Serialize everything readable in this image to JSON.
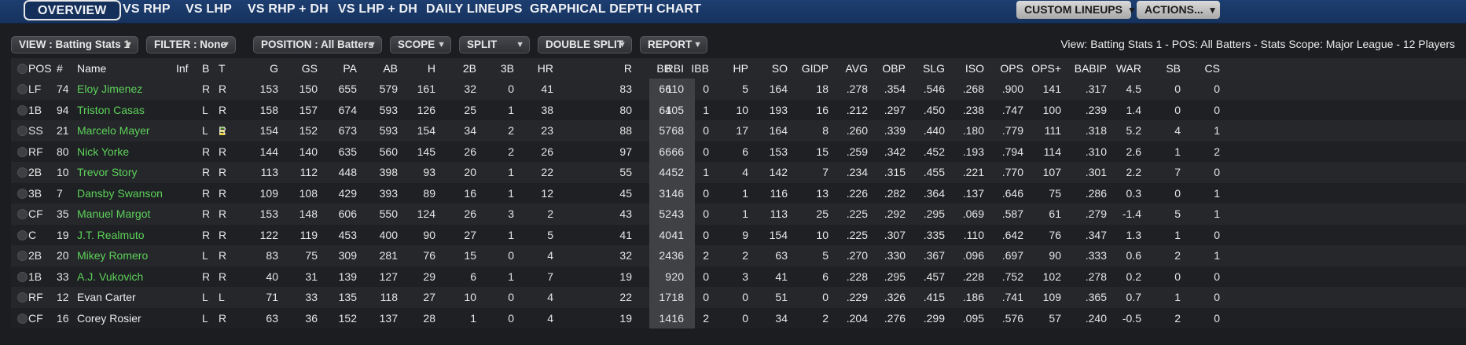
{
  "nav": {
    "tabs": [
      "OVERVIEW",
      "VS RHP",
      "VS LHP",
      "VS RHP + DH",
      "VS LHP + DH",
      "DAILY LINEUPS",
      "GRAPHICAL DEPTH CHART"
    ],
    "custom_lineups": "CUSTOM LINEUPS",
    "actions": "ACTIONS..."
  },
  "filters": {
    "view": "VIEW : Batting Stats 1",
    "filter": "FILTER : None",
    "position": "POSITION : All Batters",
    "scope": "SCOPE",
    "split": "SPLIT",
    "double_split": "DOUBLE SPLIT",
    "report": "REPORT",
    "summary": "View: Batting Stats 1 - POS: All Batters - Stats Scope: Major League - 12 Players"
  },
  "table": {
    "columns": [
      "POS",
      "#",
      "Name",
      "Inf",
      "B",
      "T",
      "G",
      "GS",
      "PA",
      "AB",
      "H",
      "2B",
      "3B",
      "HR",
      "RBI",
      "R",
      "BB",
      "IBB",
      "HP",
      "SO",
      "GIDP",
      "AVG",
      "OBP",
      "SLG",
      "ISO",
      "OPS",
      "OPS+",
      "BABIP",
      "WAR",
      "SB",
      "CS"
    ],
    "rows": [
      {
        "pos": "LF",
        "num": "74",
        "name": "Eloy Jimenez",
        "inj": "",
        "b": "R",
        "t": "R",
        "g": "153",
        "gs": "150",
        "pa": "655",
        "ab": "579",
        "h": "161",
        "d": "32",
        "tr": "0",
        "hr": "41",
        "rbi": "110",
        "r": "83",
        "bb": "66",
        "ibb": "0",
        "hp": "5",
        "so": "164",
        "gidp": "18",
        "avg": ".278",
        "obp": ".354",
        "slg": ".546",
        "iso": ".268",
        "ops": ".900",
        "opsp": "141",
        "babip": ".317",
        "war": "4.5",
        "sb": "0",
        "cs": "0",
        "green": true
      },
      {
        "pos": "1B",
        "num": "94",
        "name": "Triston Casas",
        "inj": "",
        "b": "L",
        "t": "R",
        "g": "158",
        "gs": "157",
        "pa": "674",
        "ab": "593",
        "h": "126",
        "d": "25",
        "tr": "1",
        "hr": "38",
        "rbi": "105",
        "r": "80",
        "bb": "64",
        "ibb": "1",
        "hp": "10",
        "so": "193",
        "gidp": "16",
        "avg": ".212",
        "obp": ".297",
        "slg": ".450",
        "iso": ".238",
        "ops": ".747",
        "opsp": "100",
        "babip": ".239",
        "war": "1.4",
        "sb": "0",
        "cs": "0",
        "green": true
      },
      {
        "pos": "SS",
        "num": "21",
        "name": "Marcelo Mayer",
        "inj": "yes",
        "b": "L",
        "t": "R",
        "g": "154",
        "gs": "152",
        "pa": "673",
        "ab": "593",
        "h": "154",
        "d": "34",
        "tr": "2",
        "hr": "23",
        "rbi": "68",
        "r": "88",
        "bb": "57",
        "ibb": "0",
        "hp": "17",
        "so": "164",
        "gidp": "8",
        "avg": ".260",
        "obp": ".339",
        "slg": ".440",
        "iso": ".180",
        "ops": ".779",
        "opsp": "111",
        "babip": ".318",
        "war": "5.2",
        "sb": "4",
        "cs": "1",
        "green": true
      },
      {
        "pos": "RF",
        "num": "80",
        "name": "Nick Yorke",
        "inj": "",
        "b": "R",
        "t": "R",
        "g": "144",
        "gs": "140",
        "pa": "635",
        "ab": "560",
        "h": "145",
        "d": "26",
        "tr": "2",
        "hr": "26",
        "rbi": "66",
        "r": "97",
        "bb": "66",
        "ibb": "0",
        "hp": "6",
        "so": "153",
        "gidp": "15",
        "avg": ".259",
        "obp": ".342",
        "slg": ".452",
        "iso": ".193",
        "ops": ".794",
        "opsp": "114",
        "babip": ".310",
        "war": "2.6",
        "sb": "1",
        "cs": "2",
        "green": true
      },
      {
        "pos": "2B",
        "num": "10",
        "name": "Trevor Story",
        "inj": "",
        "b": "R",
        "t": "R",
        "g": "113",
        "gs": "112",
        "pa": "448",
        "ab": "398",
        "h": "93",
        "d": "20",
        "tr": "1",
        "hr": "22",
        "rbi": "52",
        "r": "55",
        "bb": "44",
        "ibb": "1",
        "hp": "4",
        "so": "142",
        "gidp": "7",
        "avg": ".234",
        "obp": ".315",
        "slg": ".455",
        "iso": ".221",
        "ops": ".770",
        "opsp": "107",
        "babip": ".301",
        "war": "2.2",
        "sb": "7",
        "cs": "0",
        "green": true
      },
      {
        "pos": "3B",
        "num": "7",
        "name": "Dansby Swanson",
        "inj": "",
        "b": "R",
        "t": "R",
        "g": "109",
        "gs": "108",
        "pa": "429",
        "ab": "393",
        "h": "89",
        "d": "16",
        "tr": "1",
        "hr": "12",
        "rbi": "46",
        "r": "45",
        "bb": "31",
        "ibb": "0",
        "hp": "1",
        "so": "116",
        "gidp": "13",
        "avg": ".226",
        "obp": ".282",
        "slg": ".364",
        "iso": ".137",
        "ops": ".646",
        "opsp": "75",
        "babip": ".286",
        "war": "0.3",
        "sb": "0",
        "cs": "1",
        "green": true
      },
      {
        "pos": "CF",
        "num": "35",
        "name": "Manuel Margot",
        "inj": "",
        "b": "R",
        "t": "R",
        "g": "153",
        "gs": "148",
        "pa": "606",
        "ab": "550",
        "h": "124",
        "d": "26",
        "tr": "3",
        "hr": "2",
        "rbi": "43",
        "r": "43",
        "bb": "52",
        "ibb": "0",
        "hp": "1",
        "so": "113",
        "gidp": "25",
        "avg": ".225",
        "obp": ".292",
        "slg": ".295",
        "iso": ".069",
        "ops": ".587",
        "opsp": "61",
        "babip": ".279",
        "war": "-1.4",
        "sb": "5",
        "cs": "1",
        "green": true
      },
      {
        "pos": "C",
        "num": "19",
        "name": "J.T. Realmuto",
        "inj": "",
        "b": "R",
        "t": "R",
        "g": "122",
        "gs": "119",
        "pa": "453",
        "ab": "400",
        "h": "90",
        "d": "27",
        "tr": "1",
        "hr": "5",
        "rbi": "41",
        "r": "41",
        "bb": "40",
        "ibb": "0",
        "hp": "9",
        "so": "154",
        "gidp": "10",
        "avg": ".225",
        "obp": ".307",
        "slg": ".335",
        "iso": ".110",
        "ops": ".642",
        "opsp": "76",
        "babip": ".347",
        "war": "1.3",
        "sb": "1",
        "cs": "0",
        "green": true
      },
      {
        "pos": "2B",
        "num": "20",
        "name": "Mikey Romero",
        "inj": "",
        "b": "L",
        "t": "R",
        "g": "83",
        "gs": "75",
        "pa": "309",
        "ab": "281",
        "h": "76",
        "d": "15",
        "tr": "0",
        "hr": "4",
        "rbi": "36",
        "r": "32",
        "bb": "24",
        "ibb": "2",
        "hp": "2",
        "so": "63",
        "gidp": "5",
        "avg": ".270",
        "obp": ".330",
        "slg": ".367",
        "iso": ".096",
        "ops": ".697",
        "opsp": "90",
        "babip": ".333",
        "war": "0.6",
        "sb": "2",
        "cs": "1",
        "green": true
      },
      {
        "pos": "1B",
        "num": "33",
        "name": "A.J. Vukovich",
        "inj": "",
        "b": "R",
        "t": "R",
        "g": "40",
        "gs": "31",
        "pa": "139",
        "ab": "127",
        "h": "29",
        "d": "6",
        "tr": "1",
        "hr": "7",
        "rbi": "20",
        "r": "19",
        "bb": "9",
        "ibb": "0",
        "hp": "3",
        "so": "41",
        "gidp": "6",
        "avg": ".228",
        "obp": ".295",
        "slg": ".457",
        "iso": ".228",
        "ops": ".752",
        "opsp": "102",
        "babip": ".278",
        "war": "0.2",
        "sb": "0",
        "cs": "0",
        "green": true
      },
      {
        "pos": "RF",
        "num": "12",
        "name": "Evan Carter",
        "inj": "",
        "b": "L",
        "t": "L",
        "g": "71",
        "gs": "33",
        "pa": "135",
        "ab": "118",
        "h": "27",
        "d": "10",
        "tr": "0",
        "hr": "4",
        "rbi": "18",
        "r": "22",
        "bb": "17",
        "ibb": "0",
        "hp": "0",
        "so": "51",
        "gidp": "0",
        "avg": ".229",
        "obp": ".326",
        "slg": ".415",
        "iso": ".186",
        "ops": ".741",
        "opsp": "109",
        "babip": ".365",
        "war": "0.7",
        "sb": "1",
        "cs": "0",
        "green": false
      },
      {
        "pos": "CF",
        "num": "16",
        "name": "Corey Rosier",
        "inj": "",
        "b": "L",
        "t": "R",
        "g": "63",
        "gs": "36",
        "pa": "152",
        "ab": "137",
        "h": "28",
        "d": "1",
        "tr": "0",
        "hr": "4",
        "rbi": "16",
        "r": "19",
        "bb": "14",
        "ibb": "2",
        "hp": "0",
        "so": "34",
        "gidp": "2",
        "avg": ".204",
        "obp": ".276",
        "slg": ".299",
        "iso": ".095",
        "ops": ".576",
        "opsp": "57",
        "babip": ".240",
        "war": "-0.5",
        "sb": "2",
        "cs": "0",
        "green": false
      }
    ]
  }
}
